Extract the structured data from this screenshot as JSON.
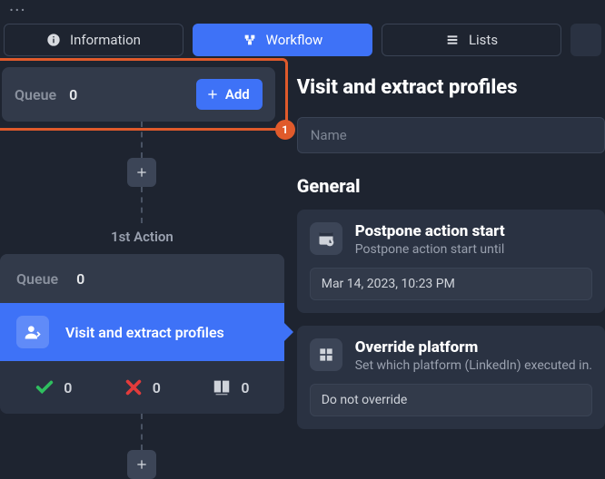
{
  "topbar_dots": "...",
  "tabs": {
    "information": "Information",
    "workflow": "Workflow",
    "lists": "Lists"
  },
  "queue1": {
    "label": "Queue",
    "count": "0",
    "add_label": "Add",
    "highlight_badge": "1"
  },
  "first_action_label": "1st Action",
  "action": {
    "queue_label": "Queue",
    "queue_count": "0",
    "title": "Visit and extract profiles",
    "stats": {
      "success": "0",
      "fail": "0",
      "profiles": "0"
    }
  },
  "panel": {
    "title": "Visit and extract profiles",
    "name_placeholder": "Name",
    "section_general": "General",
    "postpone": {
      "title": "Postpone action start",
      "desc": "Postpone action start until",
      "value": "Mar 14, 2023, 10:23 PM"
    },
    "override": {
      "title": "Override platform",
      "desc": "Set which platform (LinkedIn) executed in.",
      "value": "Do not override"
    }
  }
}
